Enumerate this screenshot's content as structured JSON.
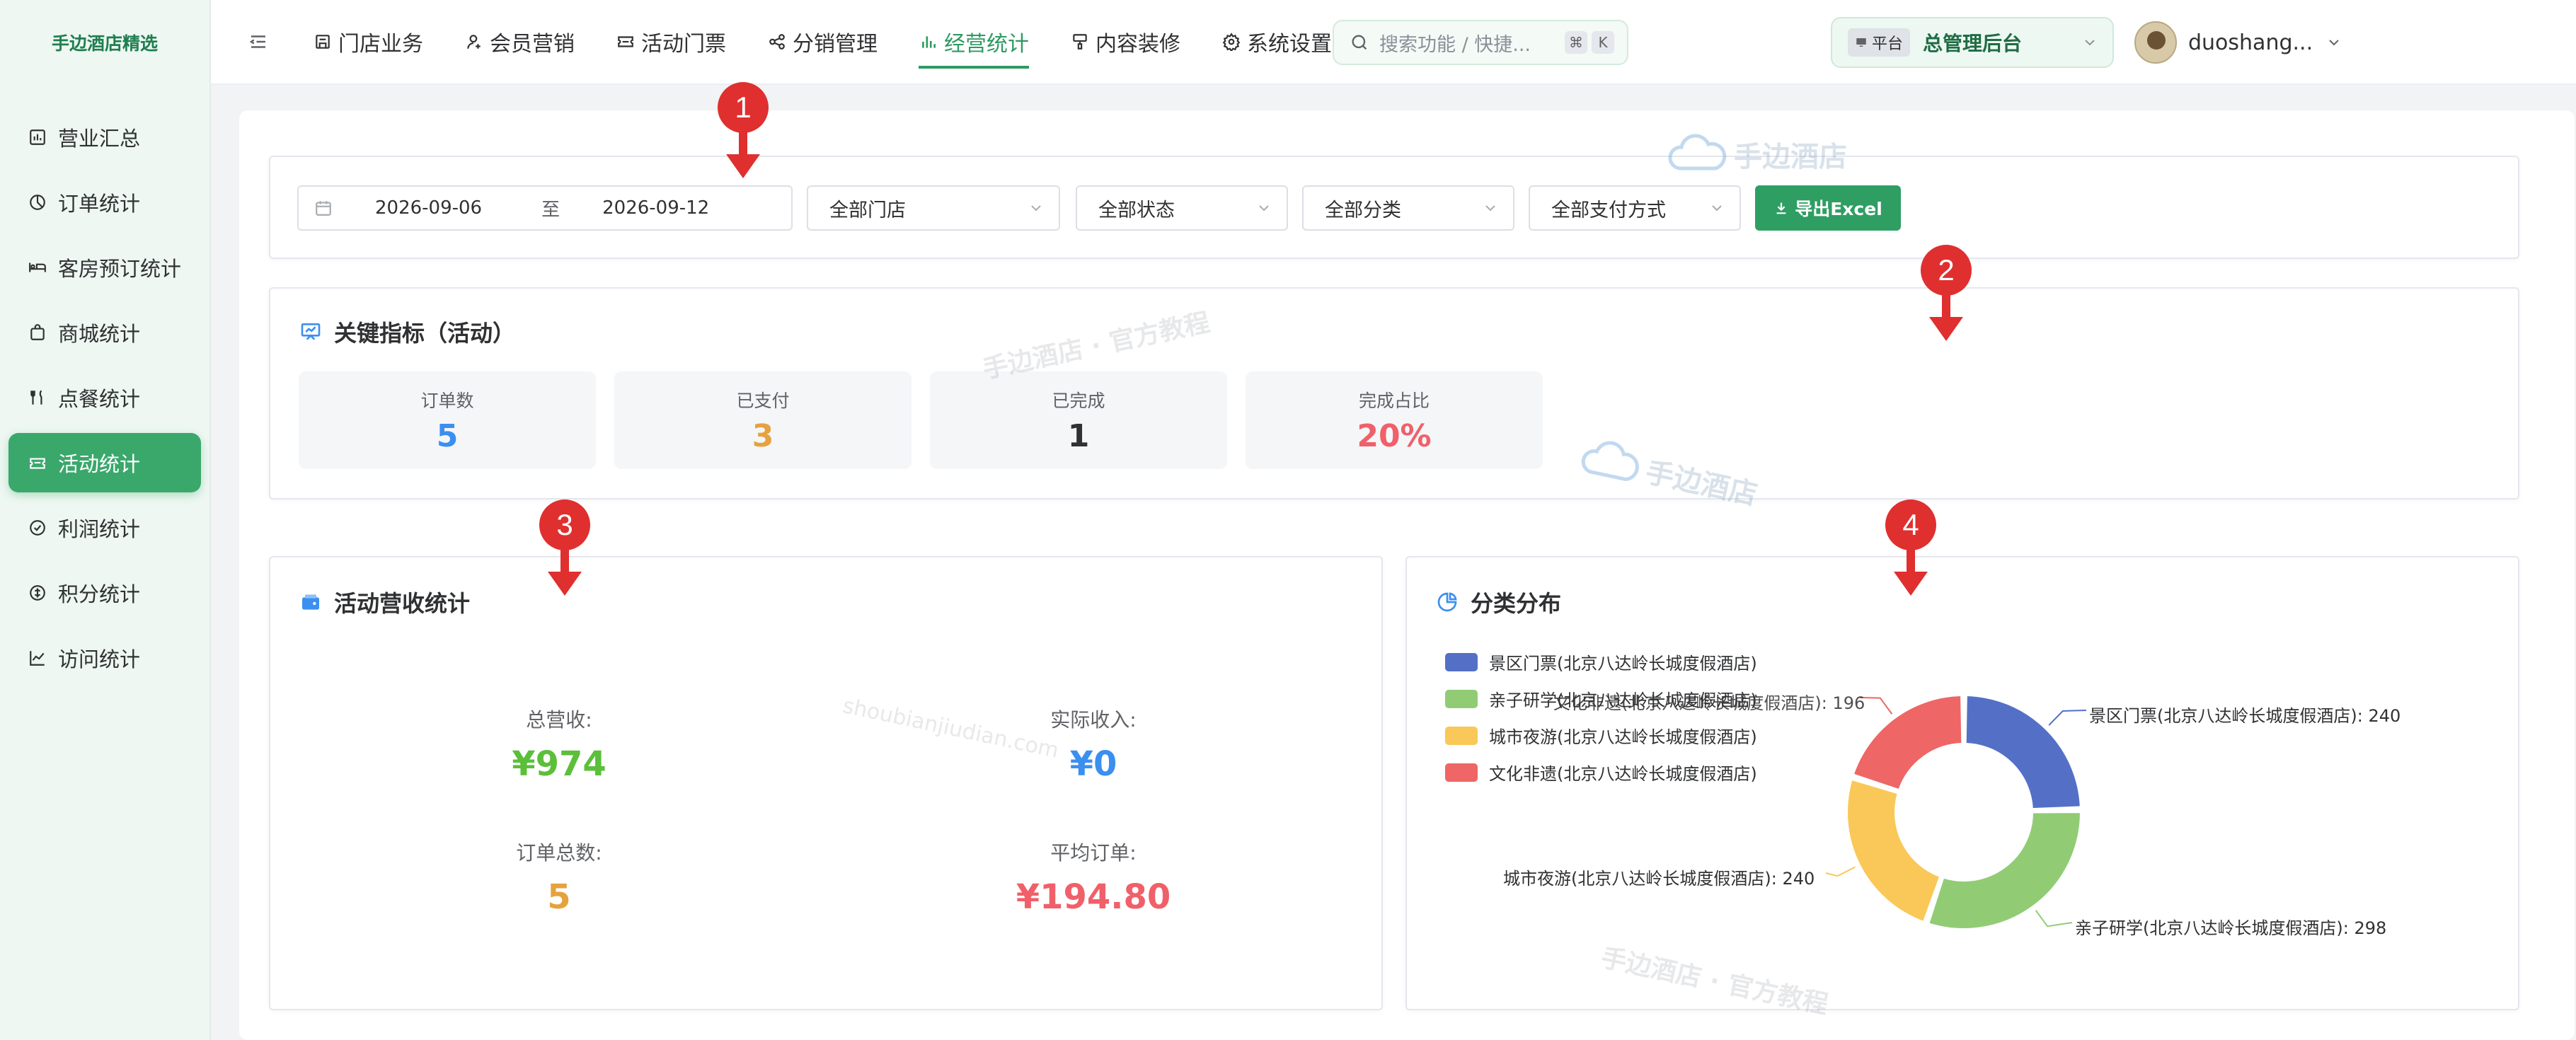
{
  "brand": "手边酒店精选",
  "sidebar": {
    "items": [
      {
        "label": "营业汇总",
        "icon": "bar-chart-icon"
      },
      {
        "label": "订单统计",
        "icon": "pie-chart-icon"
      },
      {
        "label": "客房预订统计",
        "icon": "bed-icon"
      },
      {
        "label": "商城统计",
        "icon": "bag-icon"
      },
      {
        "label": "点餐统计",
        "icon": "cutlery-icon"
      },
      {
        "label": "活动统计",
        "icon": "ticket-icon"
      },
      {
        "label": "利润统计",
        "icon": "check-circle-icon"
      },
      {
        "label": "积分统计",
        "icon": "coin-icon"
      },
      {
        "label": "访问统计",
        "icon": "line-chart-icon"
      }
    ],
    "active_index": 5
  },
  "topnav": {
    "items": [
      {
        "label": "门店业务",
        "icon": "store-icon"
      },
      {
        "label": "会员营销",
        "icon": "user-icon"
      },
      {
        "label": "活动门票",
        "icon": "ticket-icon"
      },
      {
        "label": "分销管理",
        "icon": "share-icon"
      },
      {
        "label": "经营统计",
        "icon": "stats-icon"
      },
      {
        "label": "内容装修",
        "icon": "brush-icon"
      },
      {
        "label": "系统设置",
        "icon": "gear-icon"
      }
    ],
    "active_index": 4
  },
  "search": {
    "placeholder": "搜索功能 / 快捷...",
    "kbd1": "⌘",
    "kbd2": "K"
  },
  "platform": {
    "tag": "平台",
    "name": "总管理后台"
  },
  "user": {
    "name": "duoshang..."
  },
  "filters": {
    "date_start": "2026-09-06",
    "date_sep": "至",
    "date_end": "2026-09-12",
    "store": "全部门店",
    "status": "全部状态",
    "category": "全部分类",
    "payment": "全部支付方式",
    "export_label": "导出Excel"
  },
  "kpi": {
    "title": "关键指标（活动）",
    "items": [
      {
        "label": "订单数",
        "value": "5",
        "color": "#3b8ff0"
      },
      {
        "label": "已支付",
        "value": "3",
        "color": "#e6a23c"
      },
      {
        "label": "已完成",
        "value": "1",
        "color": "#303133"
      },
      {
        "label": "完成占比",
        "value": "20%",
        "color": "#f0606a"
      }
    ]
  },
  "revenue": {
    "title": "活动营收统计",
    "total_label": "总营收:",
    "total_value": "¥974",
    "actual_label": "实际收入:",
    "actual_value": "¥0",
    "orders_label": "订单总数:",
    "orders_value": "5",
    "avg_label": "平均订单:",
    "avg_value": "¥194.80",
    "colors": {
      "total": "#5bbf3a",
      "actual": "#3b8ff0",
      "orders": "#e6a23c",
      "avg": "#f0606a"
    }
  },
  "distribution": {
    "title": "分类分布",
    "chart_data": {
      "type": "pie",
      "categories": [
        "景区门票(北京八达岭长城度假酒店)",
        "亲子研学(北京八达岭长城度假酒店)",
        "城市夜游(北京八达岭长城度假酒店)",
        "文化非遗(北京八达岭长城度假酒店)"
      ],
      "values": [
        240,
        298,
        240,
        196
      ],
      "colors": [
        "#5470c6",
        "#91cc75",
        "#fac858",
        "#ee6666"
      ],
      "slice_labels": [
        "景区门票(北京八达岭长城度假酒店): 240",
        "亲子研学(北京八达岭长城度假酒店): 298",
        "城市夜游(北京八达岭长城度假酒店): 240",
        "文化非遗(北京八达岭长城度假酒店): 196"
      ],
      "legend": "top-left"
    }
  },
  "watermarks": {
    "logo_text": "手边酒店",
    "tutorial": "手边酒店 · 官方教程",
    "domain": "shoubianjiudian.com"
  },
  "markers": [
    "1",
    "2",
    "3",
    "4"
  ]
}
